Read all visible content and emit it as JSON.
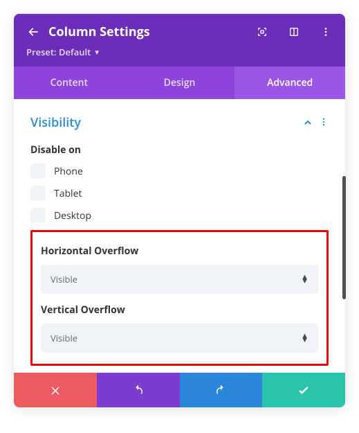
{
  "header": {
    "title": "Column Settings",
    "preset_label": "Preset: Default"
  },
  "tabs": {
    "content": "Content",
    "design": "Design",
    "advanced": "Advanced"
  },
  "section": {
    "title": "Visibility",
    "disable_on_label": "Disable on",
    "options": {
      "phone": "Phone",
      "tablet": "Tablet",
      "desktop": "Desktop"
    },
    "h_overflow_label": "Horizontal Overflow",
    "h_overflow_value": "Visible",
    "v_overflow_label": "Vertical Overflow",
    "v_overflow_value": "Visible"
  }
}
